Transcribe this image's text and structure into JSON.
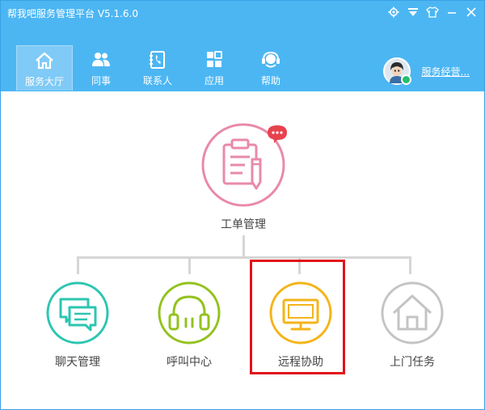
{
  "window": {
    "title": "帮我吧服务管理平台 V5.1.6.0"
  },
  "title_controls": [
    {
      "name": "settings-icon"
    },
    {
      "name": "dropdown-arrow-icon"
    },
    {
      "name": "skin-shirt-icon"
    },
    {
      "name": "minimize-icon"
    },
    {
      "name": "close-icon"
    }
  ],
  "nav": {
    "items": [
      {
        "label": "服务大厅",
        "icon": "home-icon",
        "active": true
      },
      {
        "label": "同事",
        "icon": "colleagues-icon"
      },
      {
        "label": "联系人",
        "icon": "contacts-book-icon"
      },
      {
        "label": "应用",
        "icon": "apps-grid-icon"
      },
      {
        "label": "帮助",
        "icon": "help-headset-icon"
      }
    ]
  },
  "user": {
    "name": "服务经营..."
  },
  "workflow": {
    "root": {
      "label": "工单管理",
      "color": "#e98aa8",
      "badge": "···"
    },
    "children": [
      {
        "label": "聊天管理",
        "color": "#2cc6b1"
      },
      {
        "label": "呼叫中心",
        "color": "#93c21f"
      },
      {
        "label": "远程协助",
        "color": "#f4b41a"
      },
      {
        "label": "上门任务",
        "color": "#c4c4c4"
      }
    ]
  },
  "colors": {
    "header": "#4cb6f3",
    "highlight_box": "#e2121a"
  }
}
